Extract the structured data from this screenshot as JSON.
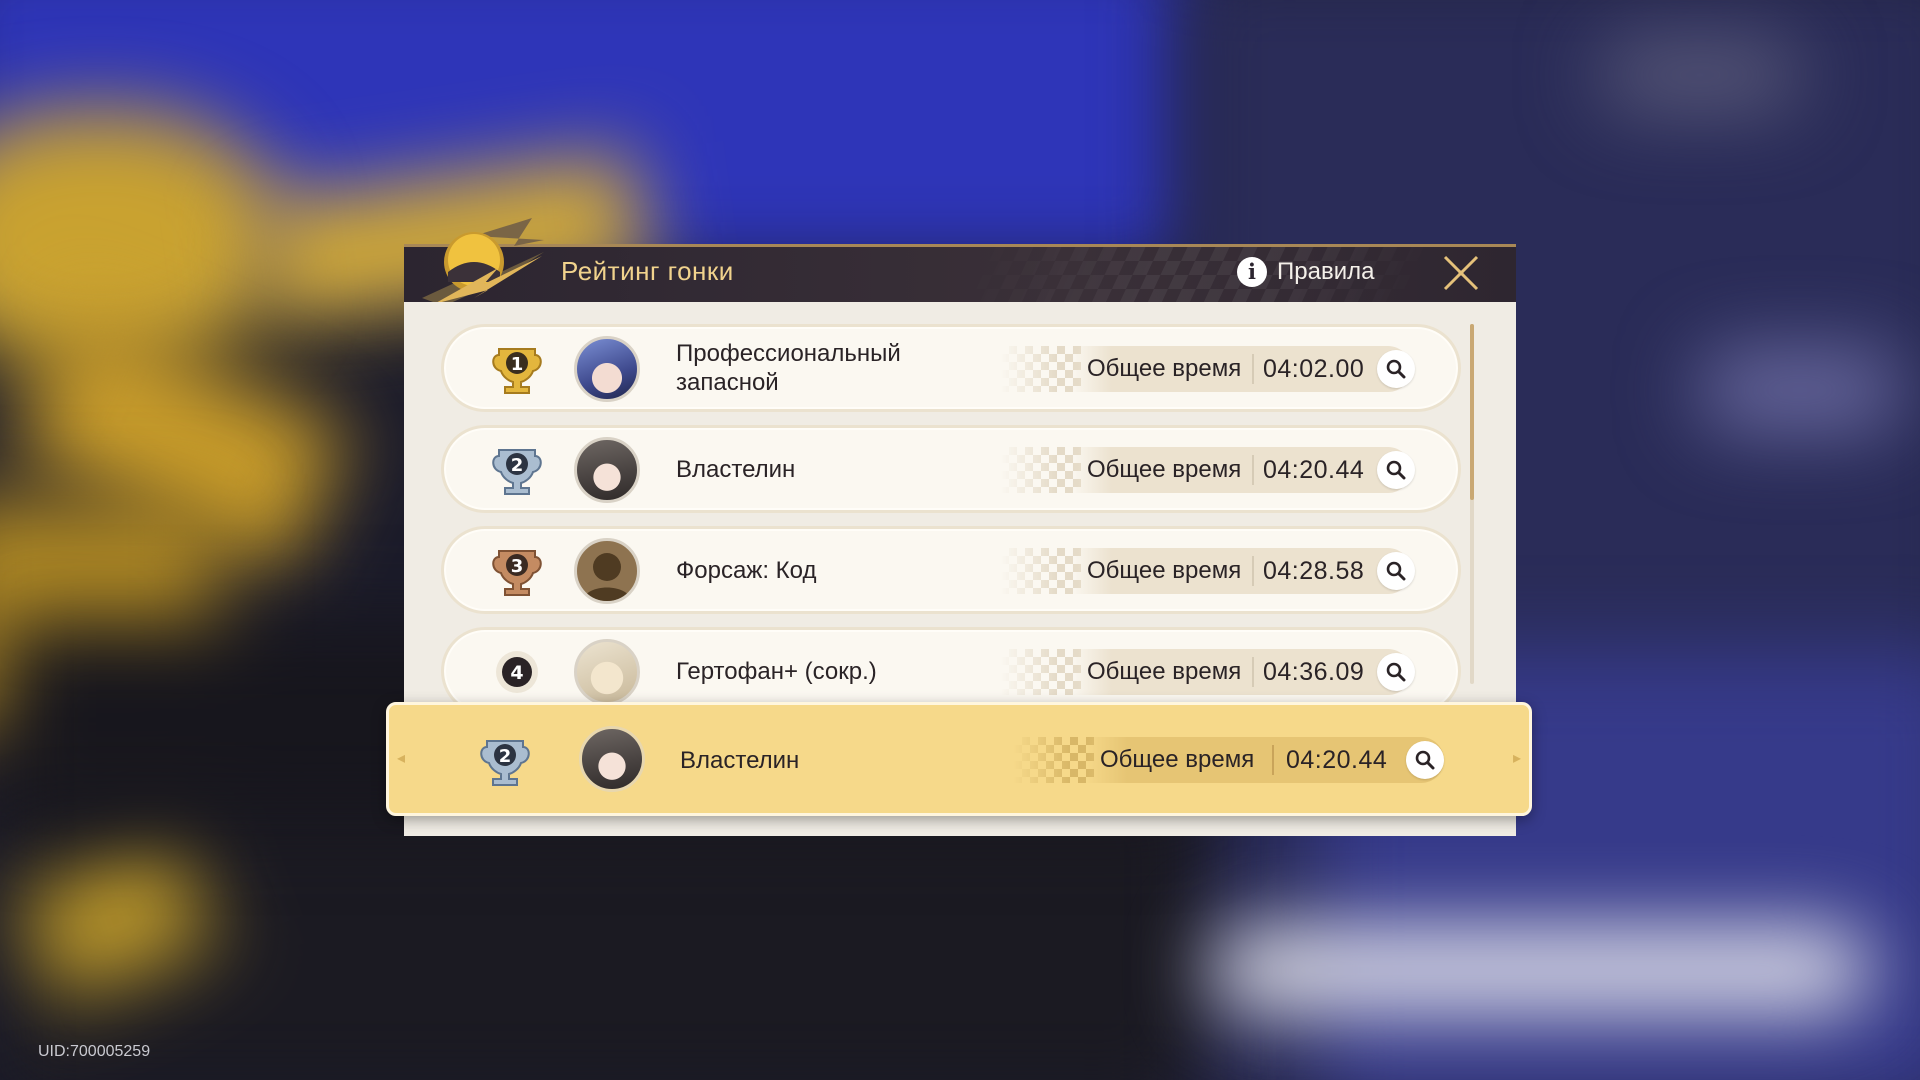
{
  "background": {
    "uid_label": "UID:700005259"
  },
  "dialog": {
    "title": "Рейтинг гонки",
    "rules_label": "Правила",
    "close_label": "close",
    "icons": {
      "logo": "sun-lightning-emblem-icon",
      "info": "info-icon",
      "close": "close-icon",
      "search": "search-icon"
    },
    "colors": {
      "header_bg": "#2c2530",
      "title": "#f1d38d",
      "list_bg": "#f0ece4",
      "row_bg": "#fbf8f1",
      "own_row_bg": "#f6d98a",
      "gold": "#e3b63d",
      "silver": "#8ea4bb",
      "bronze": "#b77d55"
    }
  },
  "leaderboard": {
    "rows": [
      {
        "rank": "1",
        "rank_style": "gold-trophy",
        "avatar": "blue-haired-girl-avatar",
        "name": "Профессиональный запасной",
        "time_label": "Общее время",
        "time": "04:02.00"
      },
      {
        "rank": "2",
        "rank_style": "silver-trophy",
        "avatar": "grey-haired-girl-avatar",
        "name": "Властелин",
        "time_label": "Общее время",
        "time": "04:20.44"
      },
      {
        "rank": "3",
        "rank_style": "bronze-trophy",
        "avatar": "silhouette-avatar",
        "name": "Форсаж: Код",
        "time_label": "Общее время",
        "time": "04:28.58"
      },
      {
        "rank": "4",
        "rank_style": "plain-circle",
        "avatar": "creature-avatar",
        "name": "Гертофан+ (сокр.)",
        "time_label": "Общее время",
        "time": "04:36.09"
      }
    ]
  },
  "own_entry": {
    "rank": "2",
    "rank_style": "silver-trophy",
    "avatar": "grey-haired-girl-avatar",
    "name": "Властелин",
    "time_label": "Общее время",
    "time": "04:20.44"
  },
  "scroll": {
    "visible_fraction": 0.49
  }
}
